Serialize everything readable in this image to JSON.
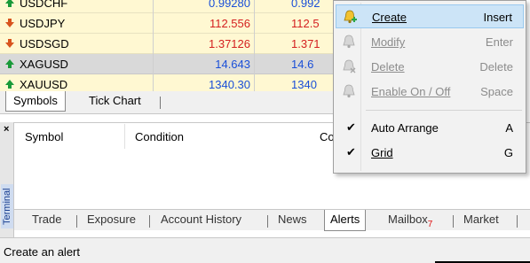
{
  "market_watch": {
    "rows": [
      {
        "symbol": "USDCHF",
        "bid": "0.99280",
        "ask": "0.992",
        "dir": "up",
        "color": "blue"
      },
      {
        "symbol": "USDJPY",
        "bid": "112.556",
        "ask": "112.5",
        "dir": "down",
        "color": "red"
      },
      {
        "symbol": "USDSGD",
        "bid": "1.37126",
        "ask": "1.371",
        "dir": "down",
        "color": "red"
      },
      {
        "symbol": "XAGUSD",
        "bid": "14.643",
        "ask": "14.6",
        "dir": "up",
        "color": "blue",
        "selected": true
      },
      {
        "symbol": "XAUUSD",
        "bid": "1340.30",
        "ask": "1340",
        "dir": "up",
        "color": "blue"
      }
    ]
  },
  "symbol_tabs": {
    "symbols": "Symbols",
    "tick_chart": "Tick Chart"
  },
  "terminal": {
    "close": "×",
    "side_label": "Terminal",
    "columns": {
      "symbol": "Symbol",
      "condition": "Condition",
      "counter": "Co"
    },
    "tabs": {
      "trade": "Trade",
      "exposure": "Exposure",
      "account_history": "Account History",
      "news": "News",
      "alerts": "Alerts",
      "mailbox": "Mailbox",
      "mailbox_count": "7",
      "market": "Market"
    }
  },
  "status_bar": {
    "text": "Create an alert"
  },
  "context_menu": {
    "items": [
      {
        "label": "Create",
        "key": "Insert",
        "enabled": true,
        "highlighted": true
      },
      {
        "label": "Modify",
        "key": "Enter",
        "enabled": false
      },
      {
        "label": "Delete",
        "key": "Delete",
        "enabled": false
      },
      {
        "label": "Enable On / Off",
        "key": "Space",
        "enabled": false
      },
      {
        "label": "Auto Arrange",
        "key": "A",
        "enabled": true,
        "checked": true
      },
      {
        "label": "Grid",
        "key": "G",
        "enabled": true,
        "checked": true
      }
    ],
    "check_glyph": "✔"
  },
  "colors": {
    "up": "#1a9a3a",
    "down": "#d8541e",
    "highlight": "#cce4f7",
    "row_bg": "#fff8d2"
  }
}
